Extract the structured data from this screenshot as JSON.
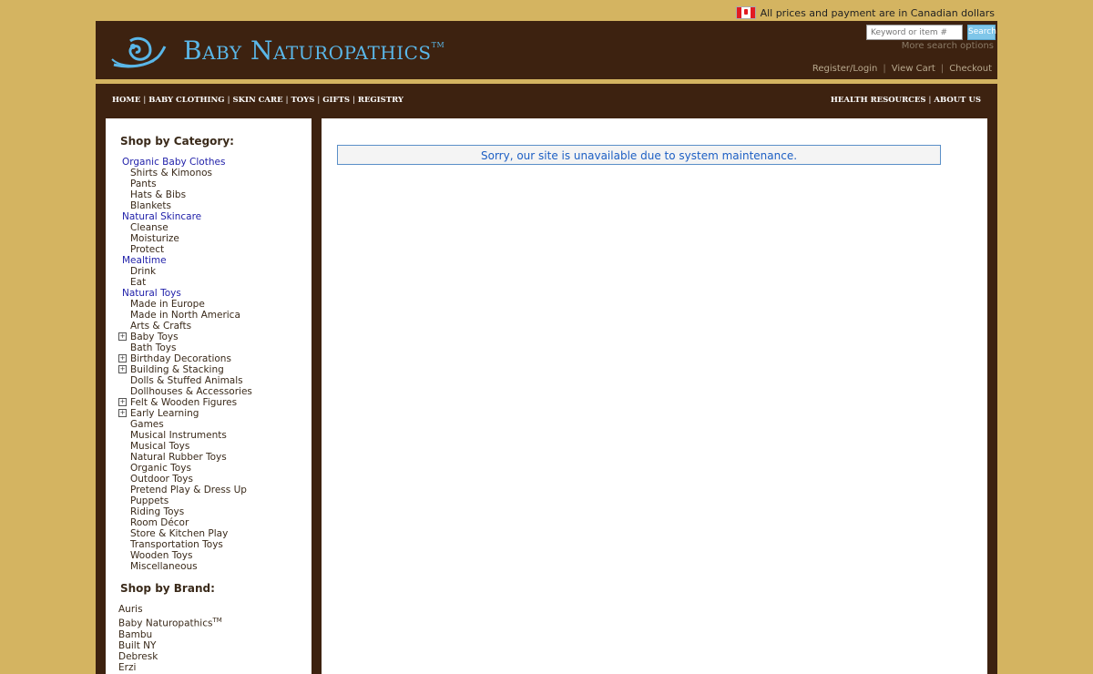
{
  "top_note": "All prices and payment are in Canadian dollars",
  "header": {
    "logo_text": "Baby Naturopathics",
    "logo_tm": "TM",
    "search_placeholder": "Keyword or item #",
    "search_button": "Search",
    "more_search": "More search options",
    "links": [
      "Register/Login",
      "View Cart",
      "Checkout"
    ]
  },
  "nav": {
    "left": [
      "HOME",
      "BABY CLOTHING",
      "SKIN CARE",
      "TOYS",
      "GIFTS",
      "REGISTRY"
    ],
    "right": [
      "HEALTH RESOURCES",
      "ABOUT US"
    ]
  },
  "sidebar": {
    "category_title": "Shop by Category:",
    "categories": [
      {
        "label": "Organic Baby Clothes",
        "level": "top",
        "expandable": false
      },
      {
        "label": "Shirts & Kimonos",
        "level": "sub",
        "expandable": false
      },
      {
        "label": "Pants",
        "level": "sub",
        "expandable": false
      },
      {
        "label": "Hats & Bibs",
        "level": "sub",
        "expandable": false
      },
      {
        "label": "Blankets",
        "level": "sub",
        "expandable": false
      },
      {
        "label": "Natural Skincare",
        "level": "top",
        "expandable": false
      },
      {
        "label": "Cleanse",
        "level": "sub",
        "expandable": false
      },
      {
        "label": "Moisturize",
        "level": "sub",
        "expandable": false
      },
      {
        "label": "Protect",
        "level": "sub",
        "expandable": false
      },
      {
        "label": "Mealtime",
        "level": "top",
        "expandable": false
      },
      {
        "label": "Drink",
        "level": "sub",
        "expandable": false
      },
      {
        "label": "Eat",
        "level": "sub",
        "expandable": false
      },
      {
        "label": "Natural Toys",
        "level": "top",
        "expandable": false
      },
      {
        "label": "Made in Europe",
        "level": "sub",
        "expandable": false
      },
      {
        "label": "Made in North America",
        "level": "sub",
        "expandable": false
      },
      {
        "label": "Arts & Crafts",
        "level": "sub",
        "expandable": false
      },
      {
        "label": "Baby Toys",
        "level": "sub",
        "expandable": true
      },
      {
        "label": "Bath Toys",
        "level": "sub",
        "expandable": false
      },
      {
        "label": "Birthday Decorations",
        "level": "sub",
        "expandable": true
      },
      {
        "label": "Building & Stacking",
        "level": "sub",
        "expandable": true
      },
      {
        "label": "Dolls & Stuffed Animals",
        "level": "sub",
        "expandable": false
      },
      {
        "label": "Dollhouses & Accessories",
        "level": "sub",
        "expandable": false
      },
      {
        "label": "Felt & Wooden Figures",
        "level": "sub",
        "expandable": true
      },
      {
        "label": "Early Learning",
        "level": "sub",
        "expandable": true
      },
      {
        "label": "Games",
        "level": "sub",
        "expandable": false
      },
      {
        "label": "Musical Instruments",
        "level": "sub",
        "expandable": false
      },
      {
        "label": "Musical Toys",
        "level": "sub",
        "expandable": false
      },
      {
        "label": "Natural Rubber Toys",
        "level": "sub",
        "expandable": false
      },
      {
        "label": "Organic Toys",
        "level": "sub",
        "expandable": false
      },
      {
        "label": "Outdoor Toys",
        "level": "sub",
        "expandable": false
      },
      {
        "label": "Pretend Play & Dress Up",
        "level": "sub",
        "expandable": false
      },
      {
        "label": "Puppets",
        "level": "sub",
        "expandable": false
      },
      {
        "label": "Riding Toys",
        "level": "sub",
        "expandable": false
      },
      {
        "label": "Room Décor",
        "level": "sub",
        "expandable": false
      },
      {
        "label": "Store & Kitchen Play",
        "level": "sub",
        "expandable": false
      },
      {
        "label": "Transportation Toys",
        "level": "sub",
        "expandable": false
      },
      {
        "label": "Wooden Toys",
        "level": "sub",
        "expandable": false
      },
      {
        "label": "Miscellaneous",
        "level": "sub",
        "expandable": false
      }
    ],
    "brand_title": "Shop by Brand:",
    "brands": [
      "Auris",
      "Baby Naturopathics",
      "Bambu",
      "Built NY",
      "Debresk",
      "Erzi"
    ],
    "brand_tm": "TM"
  },
  "main": {
    "notice": "Sorry, our site is unavailable due to system maintenance."
  },
  "colors": {
    "background": "#d4b461",
    "frame": "#3d2210",
    "logo": "#5ab7e8",
    "link": "#2222aa",
    "notice_text": "#1d5fc4"
  }
}
